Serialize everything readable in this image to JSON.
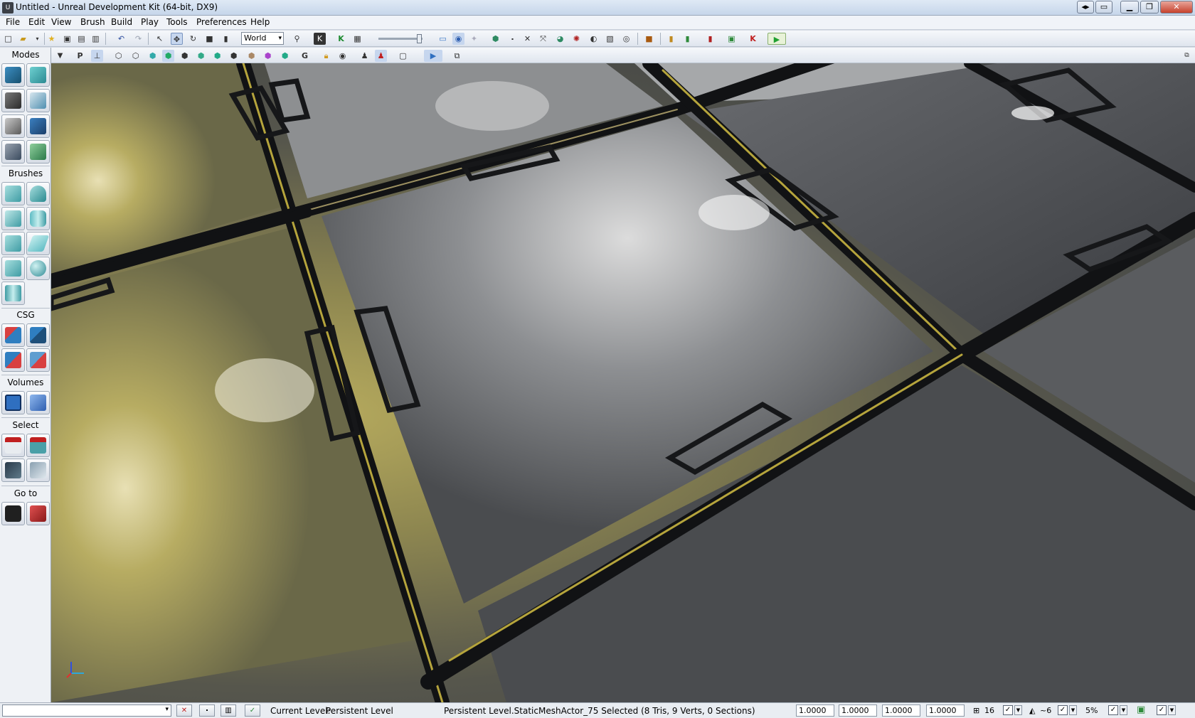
{
  "window": {
    "title": "Untitled - Unreal Development Kit (64-bit, DX9)",
    "app_icon_label": "U"
  },
  "menu": [
    "File",
    "Edit",
    "View",
    "Brush",
    "Build",
    "Play",
    "Tools",
    "Preferences",
    "Help"
  ],
  "toolbar": {
    "coordinate_system": "World",
    "coord_dropdown_arrow": "▾"
  },
  "modes_panel": {
    "sections": [
      "Modes",
      "Brushes",
      "CSG",
      "Volumes",
      "Select",
      "Go to"
    ]
  },
  "statusbar": {
    "current_level_label": "Current Level:",
    "current_level_value": "Persistent Level",
    "selection_info": "Persistent Level.StaticMeshActor_75 Selected (8 Tris, 9 Verts, 0 Sections)",
    "drag_grid_fields": [
      "1.0000",
      "1.0000",
      "1.0000",
      "1.0000"
    ],
    "grid_size": "16",
    "rotation_snap": "~6",
    "scale_snap": "5%",
    "check_mark": "✓"
  },
  "colors": {
    "viewport_yellow": "#b8ac5e",
    "viewport_metal": "#5a5c5e",
    "seam_dark": "#111214",
    "seam_yellow": "#b5a43c"
  }
}
